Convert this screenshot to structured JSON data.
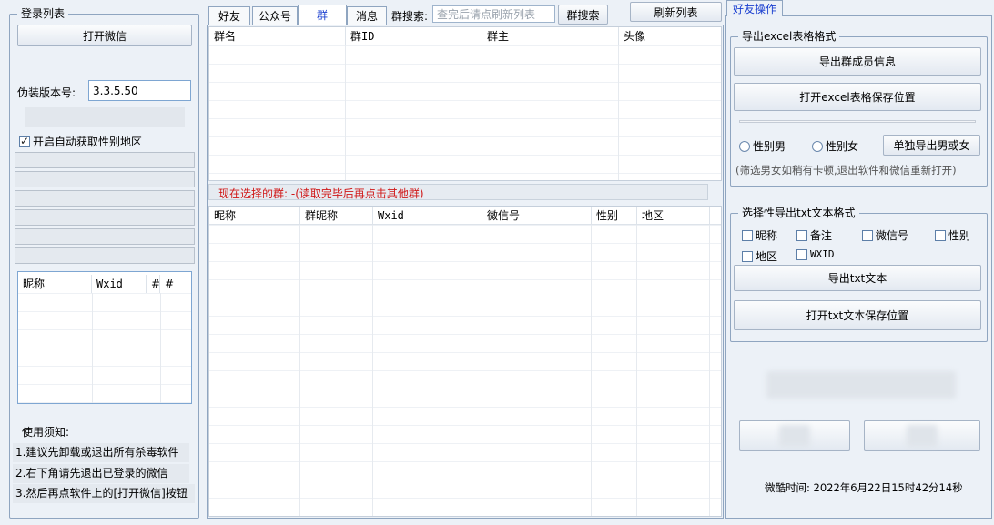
{
  "left": {
    "group_title": "登录列表",
    "open_wechat": "打开微信",
    "version_label": "伪装版本号:",
    "version_value": "3.3.5.50",
    "auto_gender_label": "开启自动获取性别地区",
    "account_table": {
      "columns": [
        "昵称",
        "Wxid",
        "#",
        "#"
      ]
    },
    "notice_title": "使用须知:",
    "notice_items": [
      "1.建议先卸载或退出所有杀毒软件",
      "2.右下角请先退出已登录的微信",
      "3.然后再点软件上的[打开微信]按钮"
    ]
  },
  "middle": {
    "tabs": [
      "好友",
      "公众号",
      "群",
      "消息"
    ],
    "active_tab": "群",
    "search_label": "群搜索:",
    "search_placeholder": "查完后请点刷新列表",
    "search_button": "群搜索",
    "refresh_button": "刷新列表",
    "group_table": {
      "columns": [
        "群名",
        "群ID",
        "群主",
        "头像"
      ]
    },
    "selected_group_text": "现在选择的群: -(读取完毕后再点击其他群)",
    "member_table": {
      "columns": [
        "昵称",
        "群昵称",
        "Wxid",
        "微信号",
        "性别",
        "地区"
      ]
    }
  },
  "right": {
    "tab_label": "好友操作",
    "excel_group_title": "导出excel表格格式",
    "export_members_button": "导出群成员信息",
    "open_excel_folder_button": "打开excel表格保存位置",
    "radio_male": "性别男",
    "radio_female": "性别女",
    "export_gender_button": "单独导出男或女",
    "gender_note": "(筛选男女如稍有卡顿,退出软件和微信重新打开)",
    "txt_group_title": "选择性导出txt文本格式",
    "txt_options": [
      {
        "label": "昵称",
        "checked": false
      },
      {
        "label": "备注",
        "checked": false
      },
      {
        "label": "微信号",
        "checked": false
      },
      {
        "label": "性别",
        "checked": false
      },
      {
        "label": "地区",
        "checked": false
      },
      {
        "label": "WXID",
        "checked": false
      }
    ],
    "export_txt_button": "导出txt文本",
    "open_txt_folder_button": "打开txt文本保存位置",
    "time_text": "微酷时间: 2022年6月22日15时42分14秒"
  },
  "colors": {
    "background": "#ecf1f7",
    "accent_tab": "#1a3fd0",
    "warning_text": "#d01818"
  }
}
